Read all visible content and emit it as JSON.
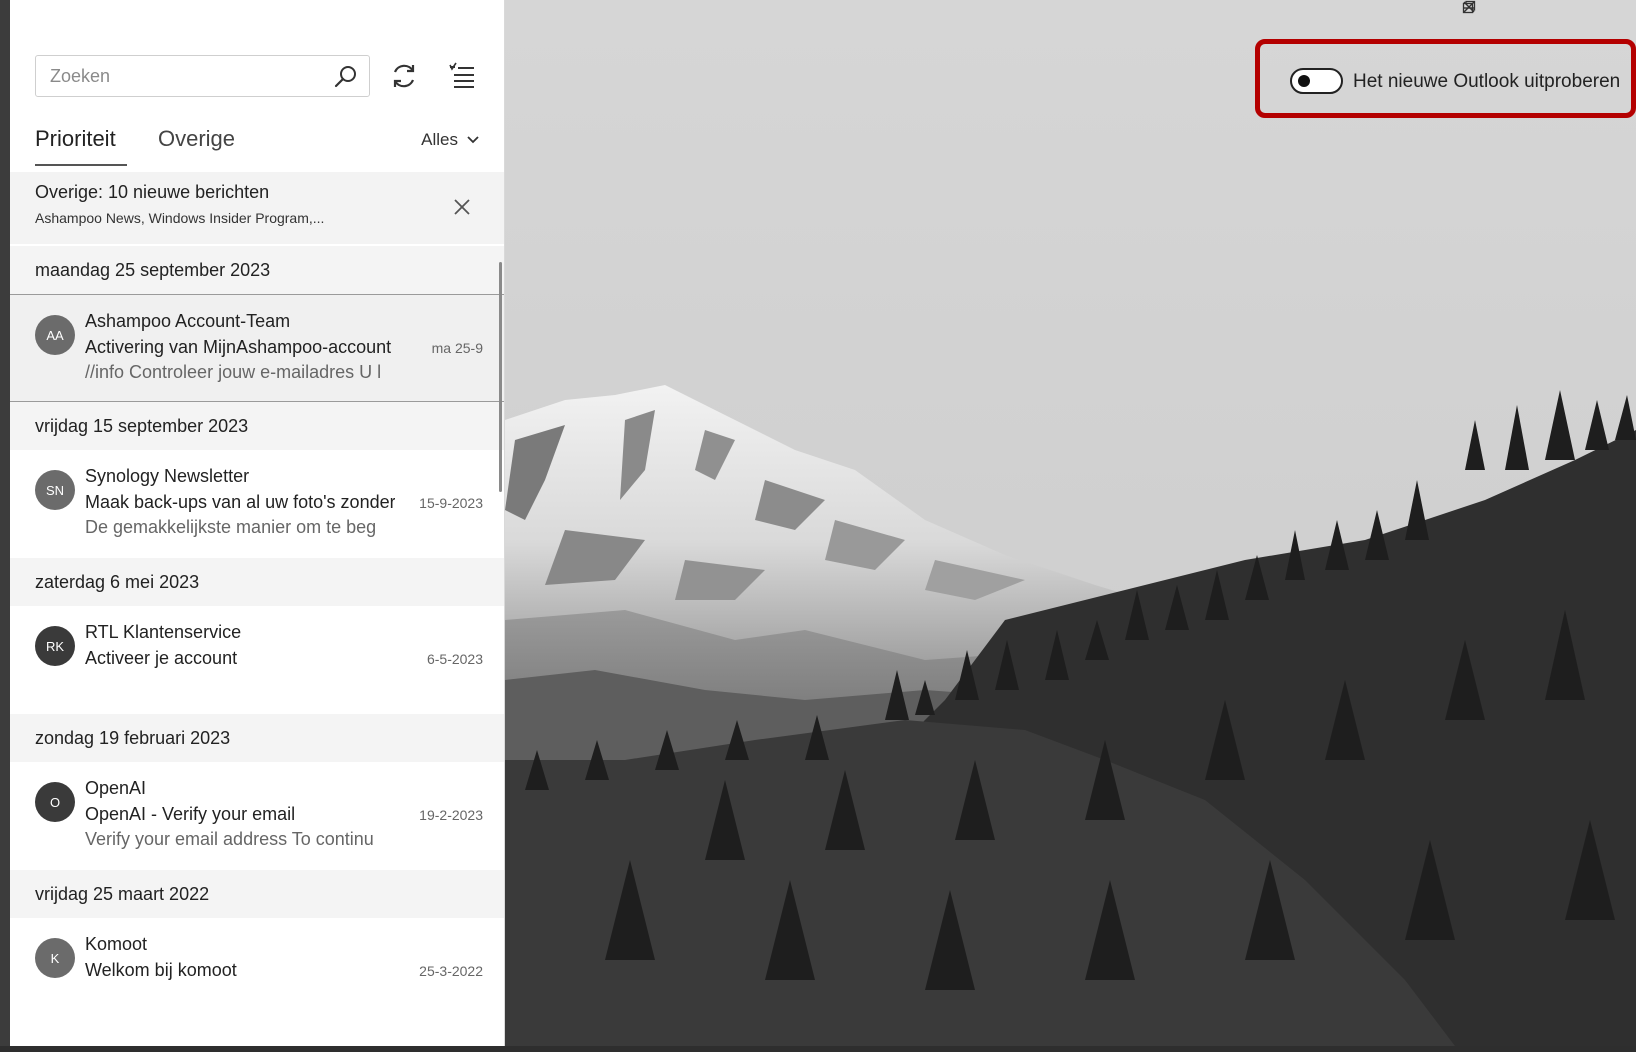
{
  "search": {
    "placeholder": "Zoeken"
  },
  "tabs": {
    "priority": "Prioriteit",
    "other": "Overige",
    "filter": "Alles"
  },
  "notice": {
    "title": "Overige: 10 nieuwe berichten",
    "subtitle": "Ashampoo News, Windows Insider Program,..."
  },
  "groups": [
    {
      "date": "maandag 25 september 2023",
      "mails": [
        {
          "initials": "AA",
          "sender": "Ashampoo Account-Team",
          "subject": "Activering van MijnAshampoo-account",
          "preview": "//info Controleer jouw e-mailadres U l",
          "date": "ma 25-9"
        }
      ]
    },
    {
      "date": "vrijdag 15 september 2023",
      "mails": [
        {
          "initials": "SN",
          "sender": "Synology Newsletter",
          "subject": "Maak back-ups van al uw foto's zonder",
          "preview": "De gemakkelijkste manier om te beg",
          "date": "15-9-2023"
        }
      ]
    },
    {
      "date": "zaterdag 6 mei 2023",
      "mails": [
        {
          "initials": "RK",
          "sender": "RTL Klantenservice",
          "subject": "Activeer je account",
          "preview": "",
          "date": "6-5-2023"
        }
      ]
    },
    {
      "date": "zondag 19 februari 2023",
      "mails": [
        {
          "initials": "O",
          "sender": "OpenAI",
          "subject": "OpenAI - Verify your email",
          "preview": "Verify your email address To continu",
          "date": "19-2-2023"
        }
      ]
    },
    {
      "date": "vrijdag 25 maart 2022",
      "mails": [
        {
          "initials": "K",
          "sender": "Komoot",
          "subject": "Welkom bij komoot",
          "preview": "",
          "date": "25-3-2022"
        }
      ]
    }
  ],
  "try_new": {
    "label": "Het nieuwe Outlook uitproberen",
    "enabled": false
  },
  "colors": {
    "highlight": "#b40000"
  }
}
